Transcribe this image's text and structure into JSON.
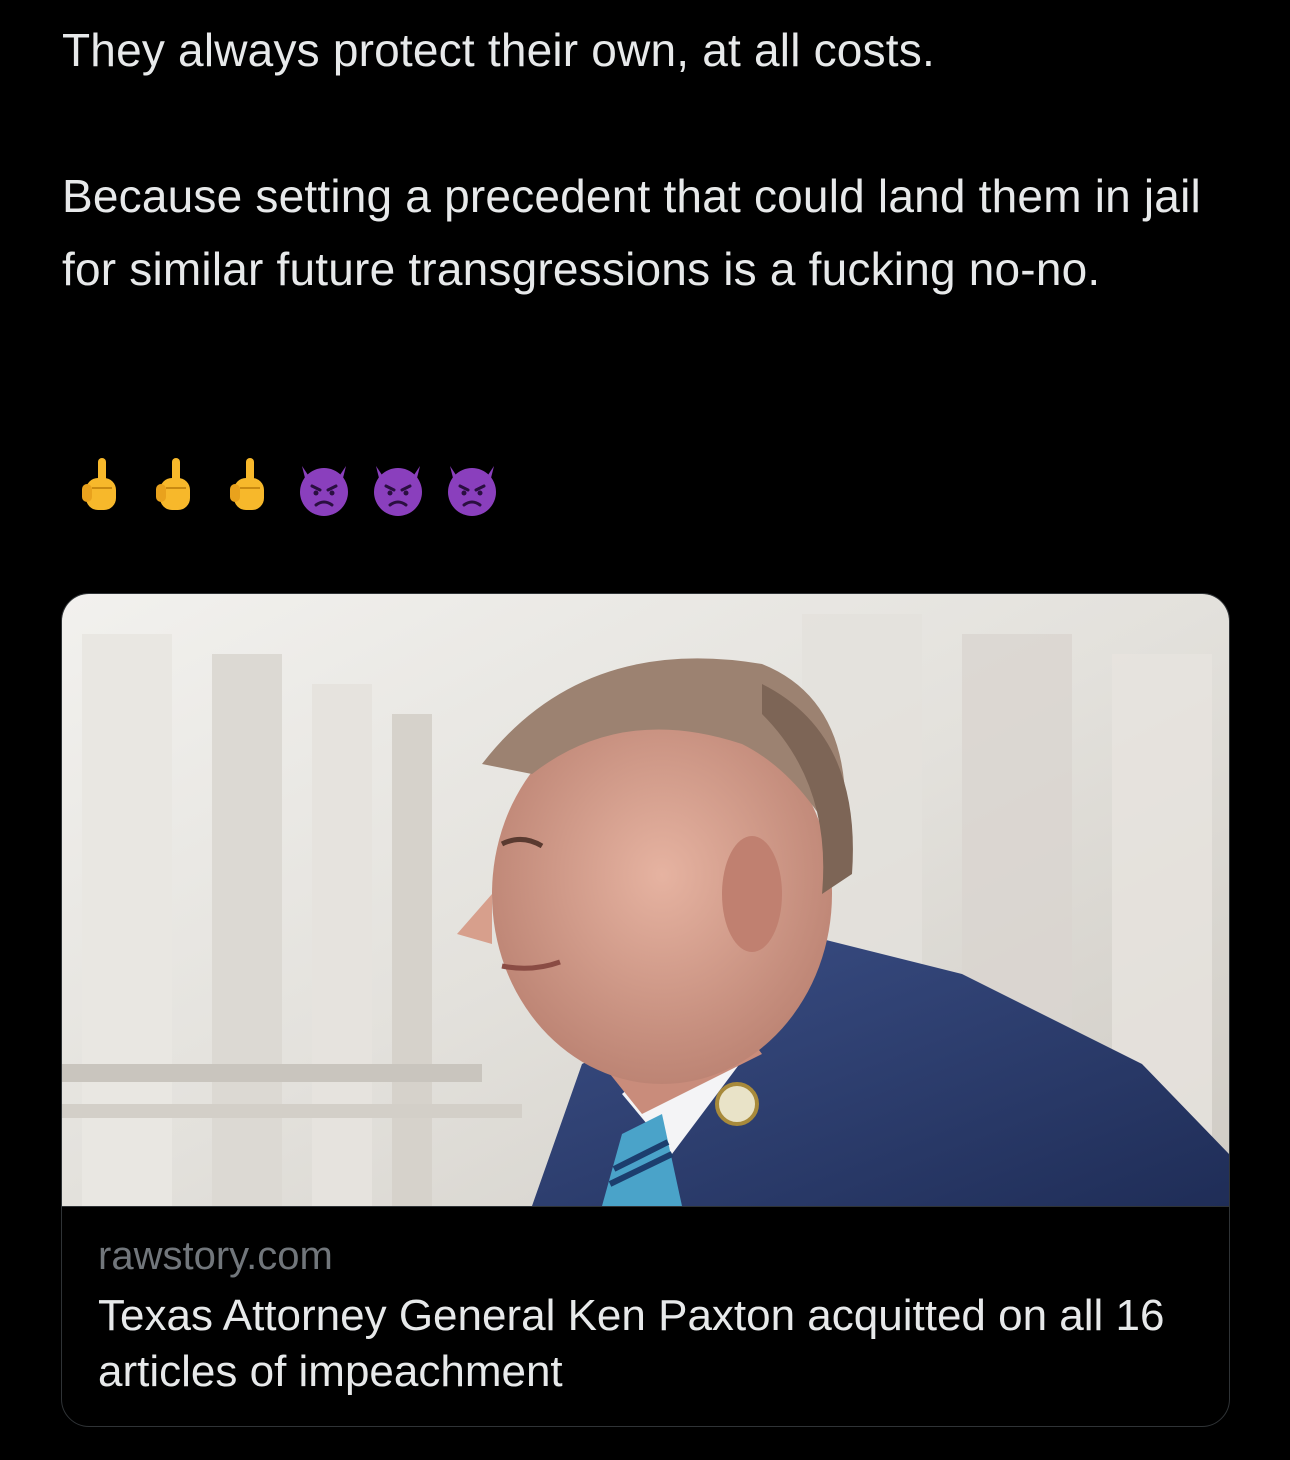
{
  "tweet": {
    "paragraphs": [
      "They always protect their own, at all costs.",
      "Because setting a precedent that could land them in jail for similar future transgressions is a fucking no-no."
    ],
    "emojis": [
      "middle-finger-icon",
      "middle-finger-icon",
      "middle-finger-icon",
      "angry-devil-icon",
      "angry-devil-icon",
      "angry-devil-icon"
    ]
  },
  "link_card": {
    "domain": "rawstory.com",
    "title": "Texas Attorney General Ken Paxton acquitted on all 16 articles of impeachment"
  },
  "colors": {
    "background": "#000000",
    "text": "#e7e9ea",
    "secondary_text": "#71767b",
    "border": "#2f3336",
    "emoji_skin": "#f7b82b",
    "emoji_devil": "#8a3fbd"
  }
}
